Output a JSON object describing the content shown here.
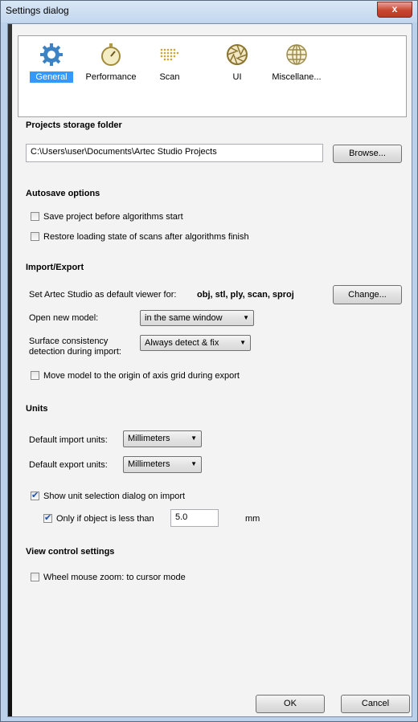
{
  "window": {
    "title": "Settings dialog",
    "close_glyph": "x"
  },
  "tabs": [
    {
      "label": "General",
      "icon": "gear-icon",
      "selected": true
    },
    {
      "label": "Performance",
      "icon": "stopwatch-icon",
      "selected": false
    },
    {
      "label": "Scan",
      "icon": "dots-grid-icon",
      "selected": false
    },
    {
      "label": "UI",
      "icon": "aperture-icon",
      "selected": false
    },
    {
      "label": "Miscellane...",
      "icon": "globe-icon",
      "selected": false
    }
  ],
  "projects": {
    "header": "Projects storage folder",
    "path": "C:\\Users\\user\\Documents\\Artec Studio Projects",
    "browse_label": "Browse..."
  },
  "autosave": {
    "header": "Autosave options",
    "save_before": {
      "label": "Save project before algorithms start",
      "checked": false
    },
    "restore_state": {
      "label": "Restore loading state of scans after algorithms finish",
      "checked": false
    }
  },
  "import_export": {
    "header": "Import/Export",
    "default_viewer_label": "Set Artec Studio as default viewer for:",
    "default_viewer_formats": "obj, stl, ply, scan, sproj",
    "change_label": "Change...",
    "open_model_label": "Open new model:",
    "open_model_value": "in the same window",
    "surface_label_1": "Surface consistency",
    "surface_label_2": "detection during import:",
    "surface_value": "Always detect & fix",
    "move_model": {
      "label": "Move model to the origin of axis grid during export",
      "checked": false
    }
  },
  "units": {
    "header": "Units",
    "import_label": "Default import units:",
    "import_value": "Millimeters",
    "export_label": "Default export units:",
    "export_value": "Millimeters",
    "show_dialog": {
      "label": "Show unit selection dialog on import",
      "checked": true
    },
    "only_if": {
      "label": "Only if object is less than",
      "checked": true
    },
    "threshold_value": "5.0",
    "threshold_unit": "mm"
  },
  "view_control": {
    "header": "View control settings",
    "wheel_zoom": {
      "label": "Wheel mouse zoom: to cursor mode",
      "checked": false
    }
  },
  "footer": {
    "ok_label": "OK",
    "cancel_label": "Cancel"
  },
  "colors": {
    "selection": "#3399ff",
    "window_frame": "#bcd2ea",
    "close_button": "#c8462f"
  }
}
